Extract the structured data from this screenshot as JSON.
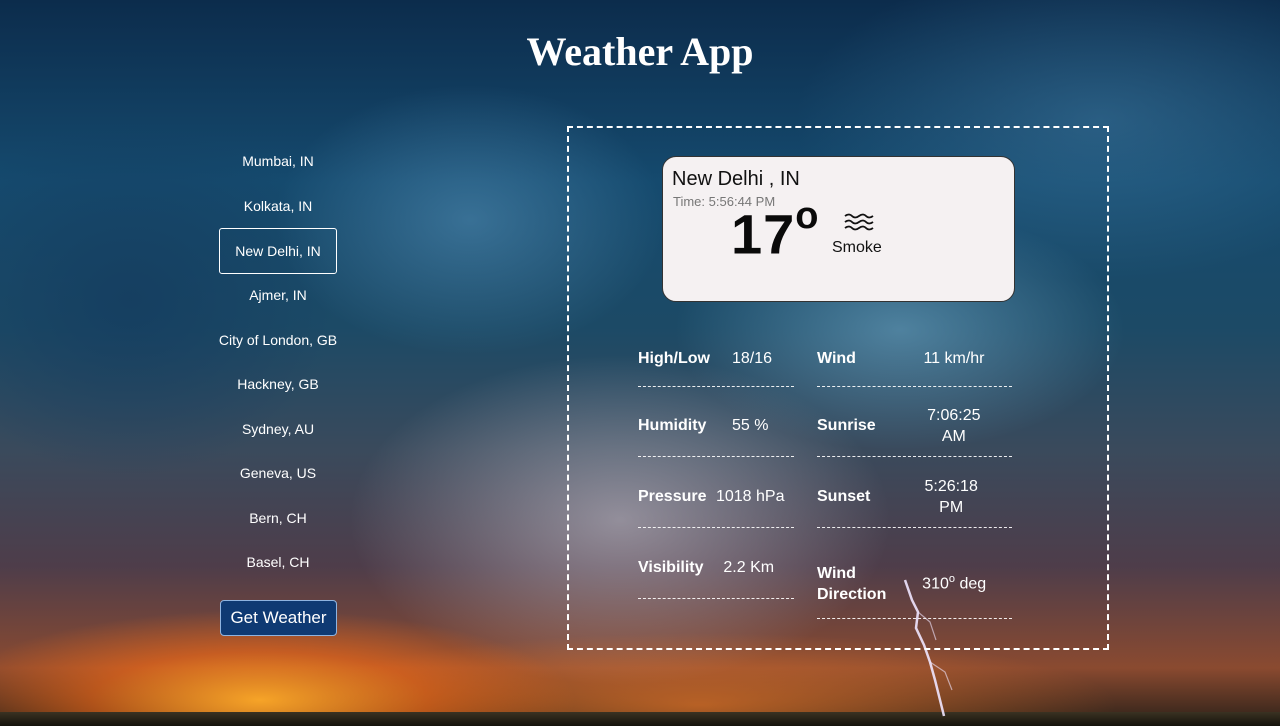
{
  "app": {
    "title": "Weather App"
  },
  "cities": [
    "Mumbai, IN",
    "Kolkata, IN",
    "New Delhi, IN",
    "Ajmer, IN",
    "City of London, GB",
    "Hackney, GB",
    "Sydney, AU",
    "Geneva, US",
    "Bern, CH",
    "Basel, CH"
  ],
  "selected_city": "New Delhi, IN",
  "get_weather_label": "Get Weather",
  "current": {
    "city": "New Delhi , IN",
    "time_label": "Time:",
    "time": "5:56:44 PM",
    "temp": "17",
    "degree_mark": "o",
    "condition": "Smoke",
    "condition_icon": "haze-icon"
  },
  "stats": {
    "high_low": {
      "label": "High/Low",
      "value": "18/16"
    },
    "wind": {
      "label": "Wind",
      "value": "11 km/hr"
    },
    "humidity": {
      "label": "Humidity",
      "value": "55 %"
    },
    "sunrise": {
      "label": "Sunrise",
      "value_line1": "7:06:25",
      "value_line2": "AM"
    },
    "pressure": {
      "label": "Pressure",
      "value": "1018 hPa"
    },
    "sunset": {
      "label": "Sunset",
      "value_line1": "5:26:18",
      "value_line2": "PM"
    },
    "visibility": {
      "label": "Visibility",
      "value": "2.2 Km"
    },
    "wind_direction": {
      "label_line1": "Wind",
      "label_line2": "Direction",
      "value": "310",
      "degree_mark": "o",
      "unit": "deg"
    }
  }
}
